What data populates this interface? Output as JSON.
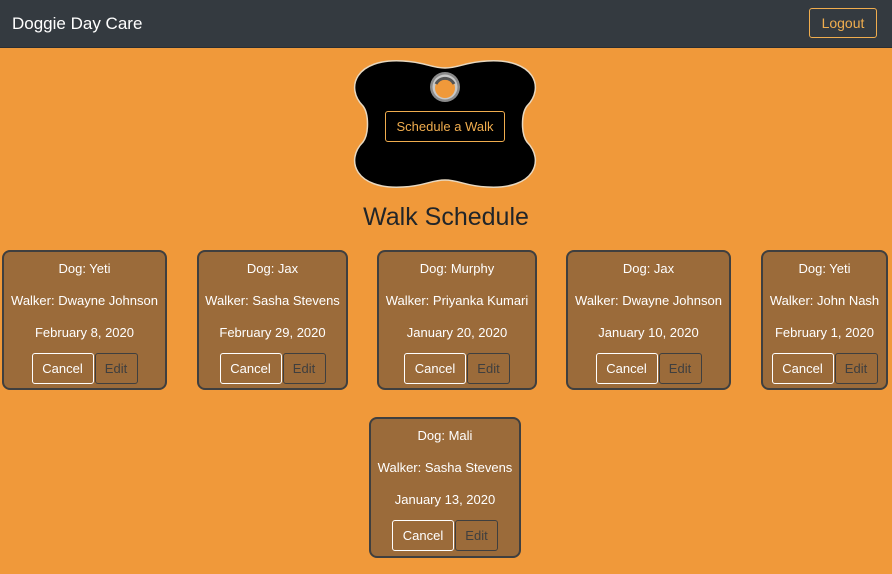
{
  "app": {
    "brand": "Doggie Day Care",
    "logout_label": "Logout"
  },
  "hero": {
    "schedule_label": "Schedule a Walk",
    "icon": "dog-bone-tag-icon"
  },
  "page": {
    "title": "Walk Schedule"
  },
  "walks": [
    {
      "dog": "Dog: Yeti",
      "walker": "Walker: Dwayne Johnson",
      "date": "February 8, 2020",
      "cancel_label": "Cancel",
      "edit_label": "Edit"
    },
    {
      "dog": "Dog: Jax",
      "walker": "Walker: Sasha Stevens",
      "date": "February 29, 2020",
      "cancel_label": "Cancel",
      "edit_label": "Edit"
    },
    {
      "dog": "Dog: Murphy",
      "walker": "Walker: Priyanka Kumari",
      "date": "January 20, 2020",
      "cancel_label": "Cancel",
      "edit_label": "Edit"
    },
    {
      "dog": "Dog: Jax",
      "walker": "Walker: Dwayne Johnson",
      "date": "January 10, 2020",
      "cancel_label": "Cancel",
      "edit_label": "Edit"
    },
    {
      "dog": "Dog: Yeti",
      "walker": "Walker: John Nash",
      "date": "February 1, 2020",
      "cancel_label": "Cancel",
      "edit_label": "Edit"
    },
    {
      "dog": "Dog: Mali",
      "walker": "Walker: Sasha Stevens",
      "date": "January 13, 2020",
      "cancel_label": "Cancel",
      "edit_label": "Edit"
    }
  ],
  "colors": {
    "background": "#f0993a",
    "navbar": "#343a40",
    "accent": "#f0ad4e",
    "card": "#9b6b3a",
    "card_border": "#3f3f3f"
  }
}
